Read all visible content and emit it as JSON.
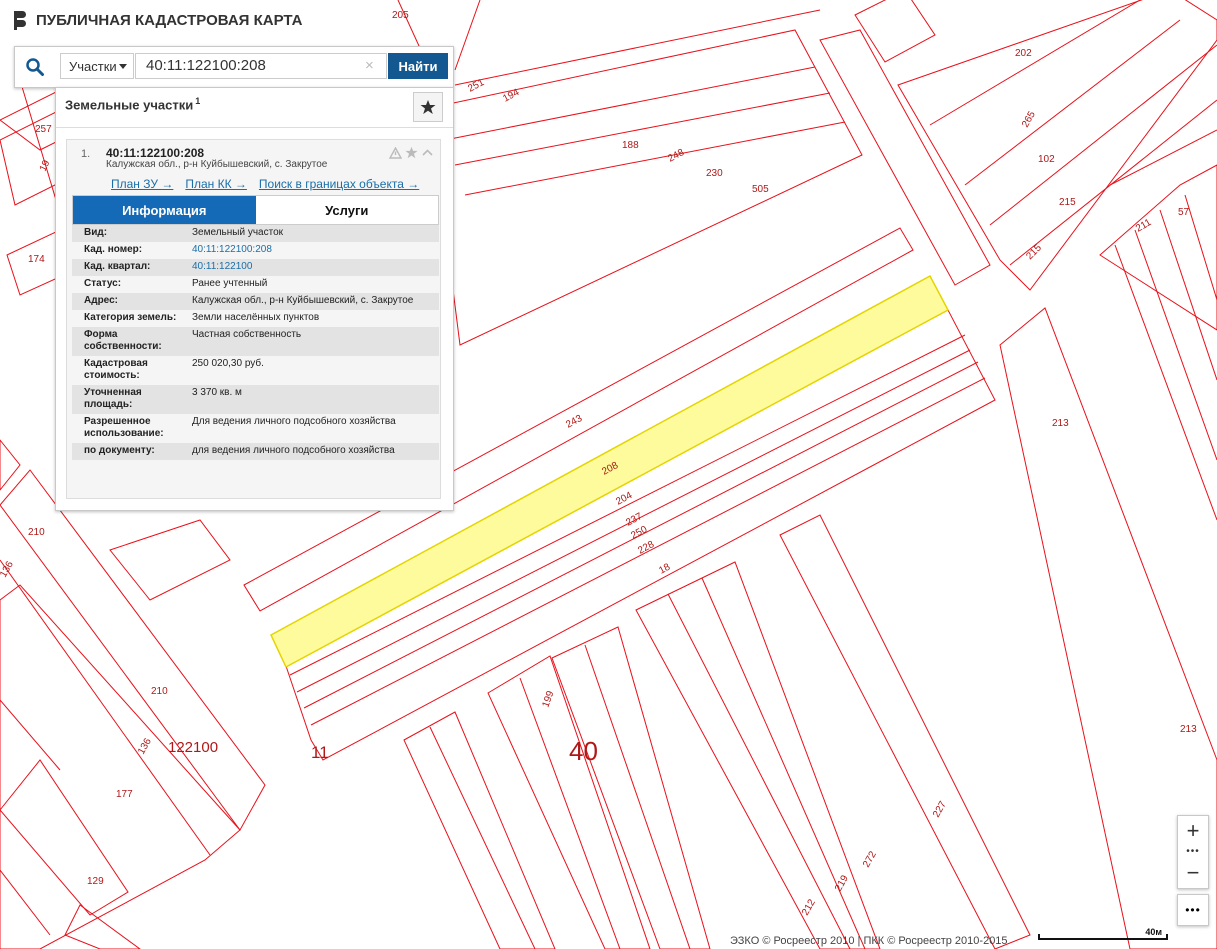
{
  "app": {
    "title": "ПУБЛИЧНАЯ КАДАСТРОВАЯ КАРТА"
  },
  "search": {
    "type_label": "Участки",
    "query": "40:11:122100:208",
    "clear_label": "×",
    "find_label": "Найти"
  },
  "results": {
    "heading": "Земельные участки",
    "count": "1",
    "item": {
      "index": "1.",
      "title": "40:11:122100:208",
      "address": "Калужская обл., р-н Куйбышевский, с. Закрутое",
      "links": [
        "План ЗУ →",
        "План КК →",
        "Поиск в границах объекта →"
      ],
      "tabs": [
        "Информация",
        "Услуги"
      ],
      "info": [
        {
          "k": "Вид:",
          "v": "Земельный участок"
        },
        {
          "k": "Кад. номер:",
          "v": "40:11:122100:208"
        },
        {
          "k": "Кад. квартал:",
          "v": "40:11:122100"
        },
        {
          "k": "Статус:",
          "v": "Ранее учтенный"
        },
        {
          "k": "Адрес:",
          "v": "Калужская обл., р-н Куйбышевский, с. Закрутое"
        },
        {
          "k": "Категория земель:",
          "v": "Земли населённых пунктов"
        },
        {
          "k": "Форма собственности:",
          "v": "Частная собственность"
        },
        {
          "k": "Кадастровая стоимость:",
          "v": "250 020,30 руб."
        },
        {
          "k": "Уточненная площадь:",
          "v": "3 370 кв. м"
        },
        {
          "k": "Разрешенное использование:",
          "v": "Для ведения личного подсобного хозяйства"
        },
        {
          "k": "по документу:",
          "v": "для ведения личного подсобного хозяйства"
        }
      ]
    }
  },
  "map": {
    "parcel_labels": [
      "205",
      "202",
      "251",
      "194",
      "188",
      "248",
      "230",
      "505",
      "265",
      "102",
      "215",
      "215",
      "211",
      "57",
      "257",
      "19",
      "174",
      "243",
      "208",
      "204",
      "237",
      "250",
      "228",
      "18",
      "199",
      "213",
      "213",
      "210",
      "136",
      "210",
      "136",
      "177",
      "129",
      "227",
      "272",
      "219",
      "212"
    ],
    "quarter_label": "122100",
    "district_labels": [
      "40",
      "11"
    ],
    "colors": {
      "boundary": "#e8101a",
      "highlight_fill": "#fdfb9c",
      "highlight_stroke": "#e6d400",
      "label": "#b01818"
    }
  },
  "controls": {
    "zoom_in": "+",
    "zoom_out": "−",
    "more": "•••"
  },
  "footer": {
    "attribution": "ЭЗКО © Росреестр 2010 | ПКК © Росреестр 2010-2015",
    "scale": "40м"
  }
}
